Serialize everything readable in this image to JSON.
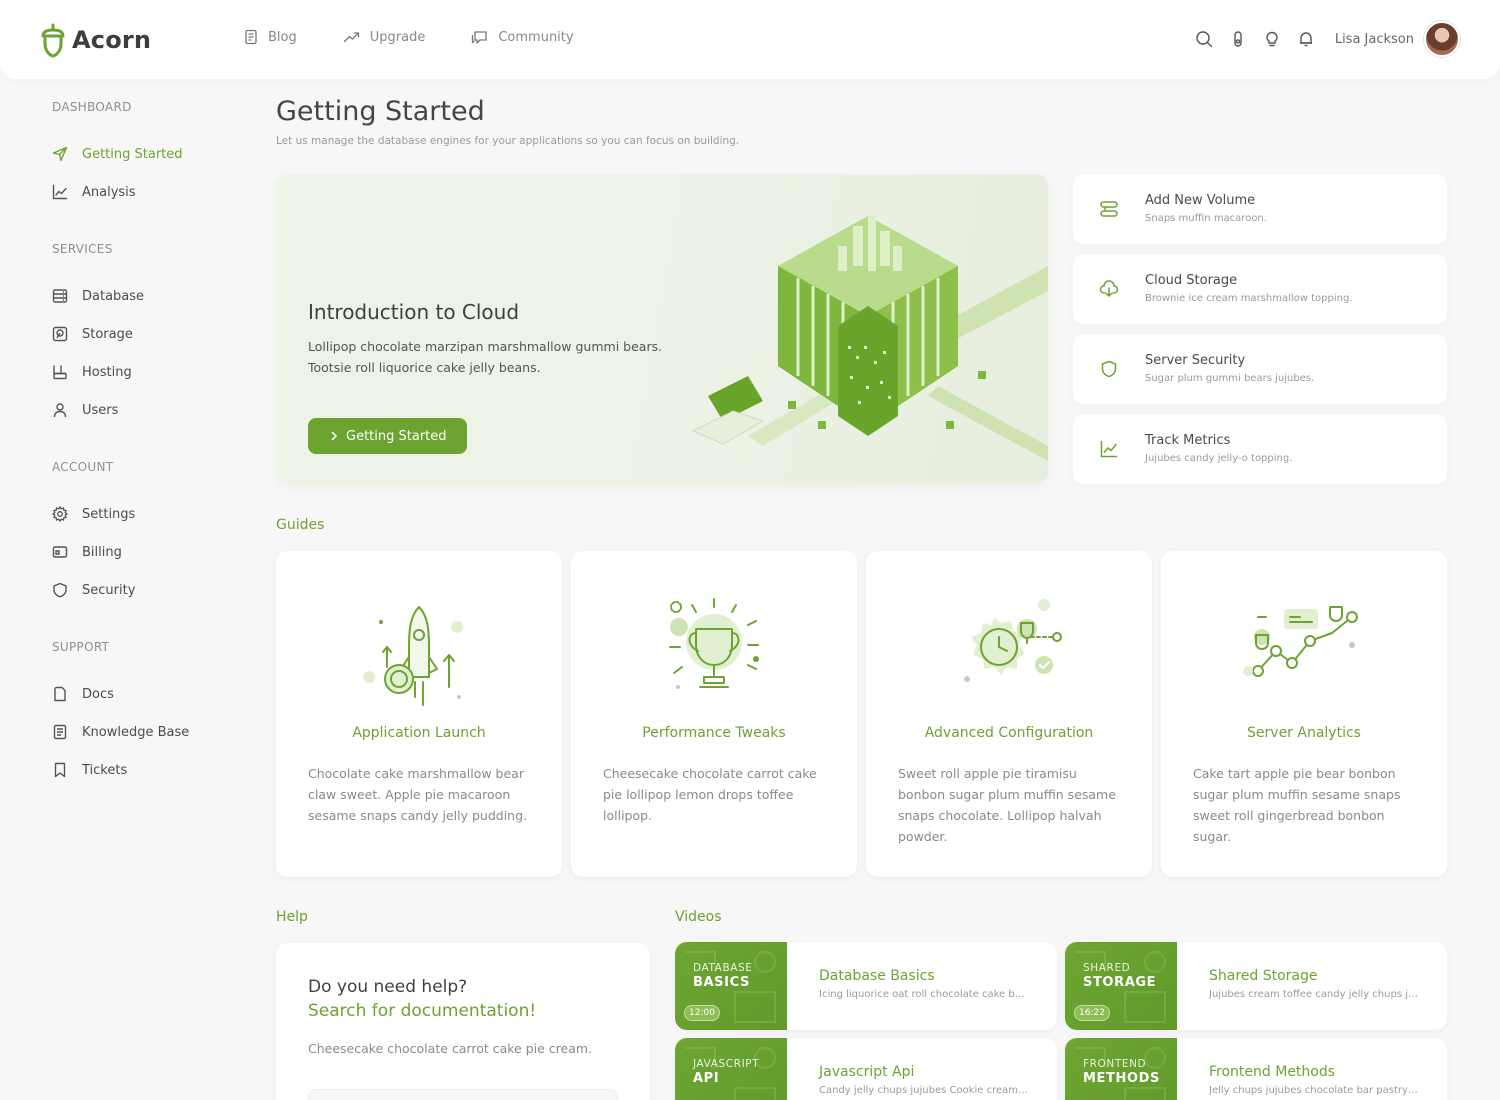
{
  "brand": {
    "name": "Acorn"
  },
  "topnav": {
    "menu": [
      {
        "label": "Blog",
        "icon": "file-text-icon"
      },
      {
        "label": "Upgrade",
        "icon": "trend-up-icon"
      },
      {
        "label": "Community",
        "icon": "chat-icon"
      }
    ],
    "user": {
      "name": "Lisa Jackson"
    }
  },
  "sidebar": {
    "sections": [
      {
        "title": "DASHBOARD",
        "items": [
          {
            "label": "Getting Started",
            "icon": "navigation-icon",
            "active": true
          },
          {
            "label": "Analysis",
            "icon": "chart-line-icon"
          }
        ]
      },
      {
        "title": "SERVICES",
        "items": [
          {
            "label": "Database",
            "icon": "database-icon"
          },
          {
            "label": "Storage",
            "icon": "storage-icon"
          },
          {
            "label": "Hosting",
            "icon": "hosting-icon"
          },
          {
            "label": "Users",
            "icon": "user-icon"
          }
        ]
      },
      {
        "title": "ACCOUNT",
        "items": [
          {
            "label": "Settings",
            "icon": "gear-icon"
          },
          {
            "label": "Billing",
            "icon": "credit-card-icon"
          },
          {
            "label": "Security",
            "icon": "shield-icon"
          }
        ]
      },
      {
        "title": "SUPPORT",
        "items": [
          {
            "label": "Docs",
            "icon": "file-icon"
          },
          {
            "label": "Knowledge Base",
            "icon": "book-icon"
          },
          {
            "label": "Tickets",
            "icon": "bookmark-icon"
          }
        ]
      }
    ]
  },
  "page": {
    "title": "Getting Started",
    "subtitle": "Let us manage the database engines for your applications so you can focus on building."
  },
  "hero": {
    "title": "Introduction to Cloud",
    "text": "Lollipop chocolate marzipan marshmallow gummi bears. Tootsie roll liquorice cake jelly beans.",
    "button": "Getting Started"
  },
  "quick_actions": [
    {
      "title": "Add New Volume",
      "subtitle": "Snaps muffin macaroon.",
      "icon": "volume-icon"
    },
    {
      "title": "Cloud Storage",
      "subtitle": "Brownie ice cream marshmallow topping.",
      "icon": "cloud-download-icon"
    },
    {
      "title": "Server Security",
      "subtitle": "Sugar plum gummi bears jujubes.",
      "icon": "shield-icon"
    },
    {
      "title": "Track Metrics",
      "subtitle": "Jujubes candy jelly-o topping.",
      "icon": "chart-line-icon"
    }
  ],
  "guides": {
    "label": "Guides",
    "items": [
      {
        "title": "Application Launch",
        "text": "Chocolate cake marshmallow bear claw sweet. Apple pie macaroon sesame snaps candy jelly pudding.",
        "icon": "rocket-icon"
      },
      {
        "title": "Performance Tweaks",
        "text": "Cheesecake chocolate carrot cake pie lollipop lemon drops toffee lollipop.",
        "icon": "trophy-icon"
      },
      {
        "title": "Advanced Configuration",
        "text": "Sweet roll apple pie tiramisu bonbon sugar plum muffin sesame snaps chocolate. Lollipop halvah powder.",
        "icon": "gear-icon"
      },
      {
        "title": "Server Analytics",
        "text": "Cake tart apple pie bear bonbon sugar plum muffin sesame snaps sweet roll gingerbread bonbon sugar.",
        "icon": "analytics-icon"
      }
    ]
  },
  "help": {
    "label": "Help",
    "question": "Do you need help?",
    "link": "Search for documentation!",
    "text": "Cheesecake chocolate carrot cake pie cream."
  },
  "videos": {
    "label": "Videos",
    "items": [
      {
        "thumb_line1": "DATABASE",
        "thumb_line2": "BASICS",
        "duration": "12:00",
        "title": "Database Basics",
        "subtitle": "Icing liquorice oat roll chocolate cake bar ..."
      },
      {
        "thumb_line1": "SHARED",
        "thumb_line2": "STORAGE",
        "duration": "16:22",
        "title": "Shared Storage",
        "subtitle": "Jujubes cream toffee candy jelly chups juju..."
      },
      {
        "thumb_line1": "JAVASCRIPT",
        "thumb_line2": "API",
        "duration": "",
        "title": "Javascript Api",
        "subtitle": "Candy jelly chups jujubes Cookie cream to..."
      },
      {
        "thumb_line1": "FRONTEND",
        "thumb_line2": "METHODS",
        "duration": "",
        "title": "Frontend Methods",
        "subtitle": "Jelly chups jujubes chocolate bar pastry o..."
      }
    ]
  },
  "colors": {
    "accent": "#6da331",
    "background": "#f7f7f7",
    "card": "#ffffff"
  }
}
